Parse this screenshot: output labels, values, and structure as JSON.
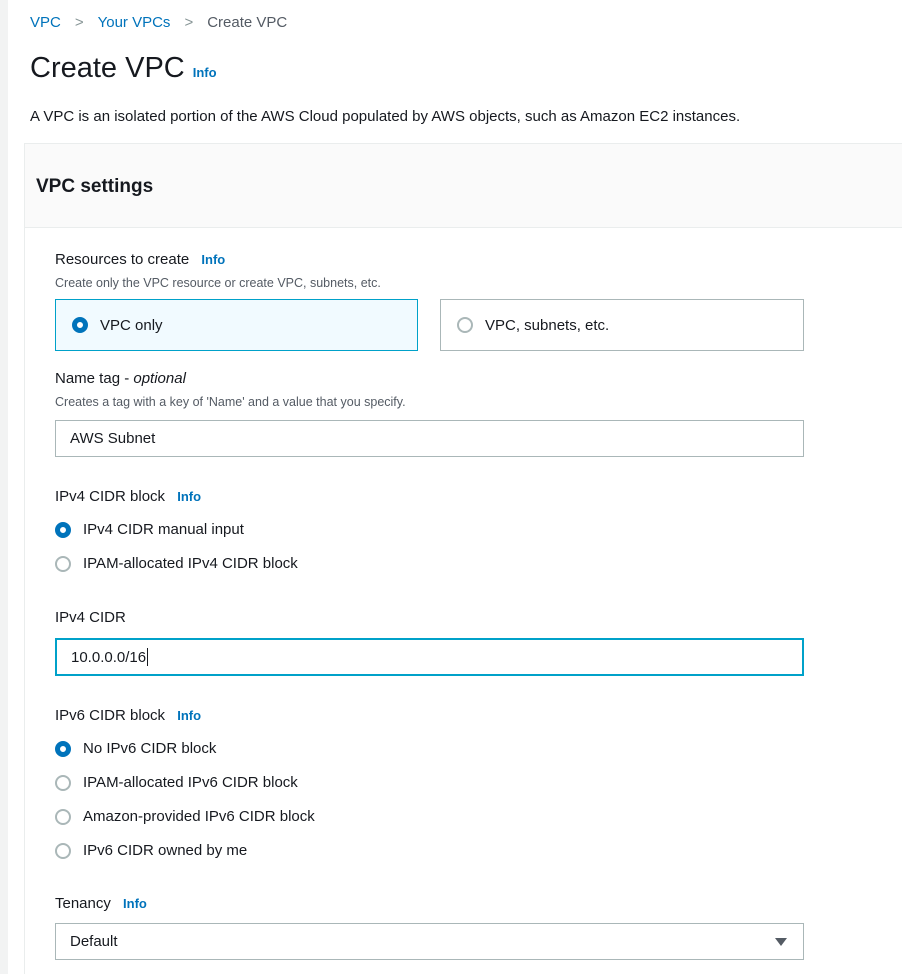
{
  "breadcrumb": {
    "items": [
      "VPC",
      "Your VPCs",
      "Create VPC"
    ],
    "separator": ">"
  },
  "page": {
    "title": "Create VPC",
    "info": "Info",
    "description": "A VPC is an isolated portion of the AWS Cloud populated by AWS objects, such as Amazon EC2 instances."
  },
  "panel": {
    "title": "VPC settings"
  },
  "resources": {
    "label": "Resources to create",
    "info": "Info",
    "description": "Create only the VPC resource or create VPC, subnets, etc.",
    "options": [
      {
        "label": "VPC only",
        "selected": true
      },
      {
        "label": "VPC, subnets, etc.",
        "selected": false
      }
    ]
  },
  "name_tag": {
    "label": "Name tag - ",
    "optional": "optional",
    "description": "Creates a tag with a key of 'Name' and a value that you specify.",
    "value": "AWS Subnet"
  },
  "ipv4_block": {
    "label": "IPv4 CIDR block",
    "info": "Info",
    "options": [
      {
        "label": "IPv4 CIDR manual input",
        "selected": true
      },
      {
        "label": "IPAM-allocated IPv4 CIDR block",
        "selected": false
      }
    ]
  },
  "ipv4_cidr": {
    "label": "IPv4 CIDR",
    "value": "10.0.0.0/16"
  },
  "ipv6_block": {
    "label": "IPv6 CIDR block",
    "info": "Info",
    "options": [
      {
        "label": "No IPv6 CIDR block",
        "selected": true
      },
      {
        "label": "IPAM-allocated IPv6 CIDR block",
        "selected": false
      },
      {
        "label": "Amazon-provided IPv6 CIDR block",
        "selected": false
      },
      {
        "label": "IPv6 CIDR owned by me",
        "selected": false
      }
    ]
  },
  "tenancy": {
    "label": "Tenancy",
    "info": "Info",
    "value": "Default"
  },
  "colors": {
    "link": "#0073bb",
    "focus": "#00a1c9",
    "selected_bg": "#f1faff"
  },
  "icons": {
    "separator": "chevron-right-icon",
    "dropdown": "caret-down-icon"
  }
}
